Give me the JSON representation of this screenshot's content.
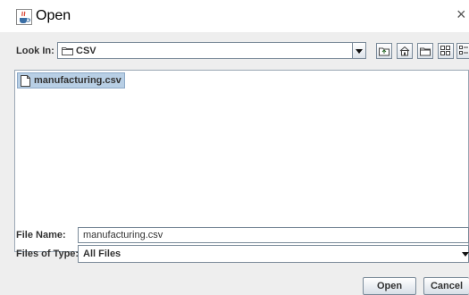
{
  "window": {
    "title": "Open",
    "close_glyph": "×"
  },
  "lookin": {
    "label": "Look In:",
    "value": "CSV"
  },
  "files": [
    {
      "name": "manufacturing.csv",
      "selected": true
    }
  ],
  "filename": {
    "label": "File Name:",
    "value": "manufacturing.csv"
  },
  "filetype": {
    "label": "Files of Type:",
    "value": "All Files"
  },
  "buttons": {
    "open": "Open",
    "cancel": "Cancel"
  },
  "icons": {
    "title": "java-cup-icon",
    "lookin": "folder-icon",
    "toolbar": [
      "up-one-level-icon",
      "home-icon",
      "new-folder-icon",
      "list-view-icon",
      "details-view-icon"
    ],
    "file": "file-icon"
  },
  "colors": {
    "selection": "#b8cfe5",
    "accent_border": "#7a8a99"
  }
}
